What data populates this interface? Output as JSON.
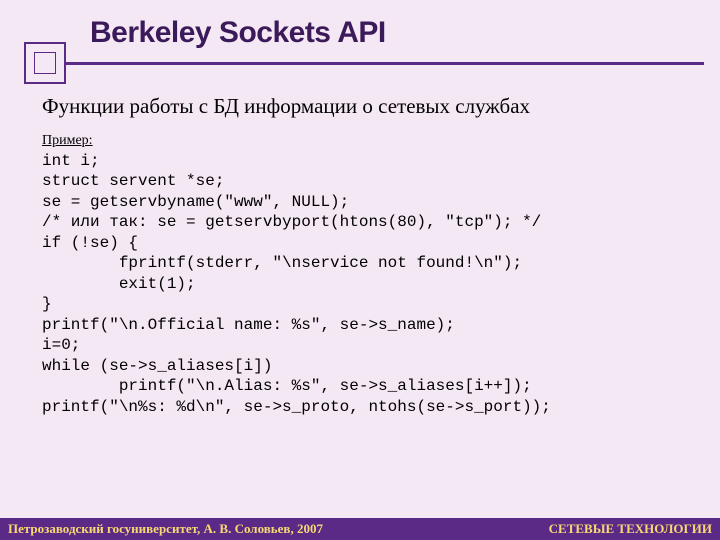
{
  "title": "Berkeley Sockets API",
  "subtitle": "Функции работы с БД информации о сетевых службах",
  "example_label": "Пример:",
  "code": "int i;\nstruct servent *se;\nse = getservbyname(\"www\", NULL);\n/* или так: se = getservbyport(htons(80), \"tcp\"); */\nif (!se) {\n        fprintf(stderr, \"\\nservice not found!\\n\");\n        exit(1);\n}\nprintf(\"\\n.Official name: %s\", se->s_name);\ni=0;\nwhile (se->s_aliases[i])\n        printf(\"\\n.Alias: %s\", se->s_aliases[i++]);\nprintf(\"\\n%s: %d\\n\", se->s_proto, ntohs(se->s_port));",
  "footer": {
    "left": "Петрозаводский госуниверситет, А. В. Соловьев, 2007",
    "right": "СЕТЕВЫЕ ТЕХНОЛОГИИ"
  }
}
